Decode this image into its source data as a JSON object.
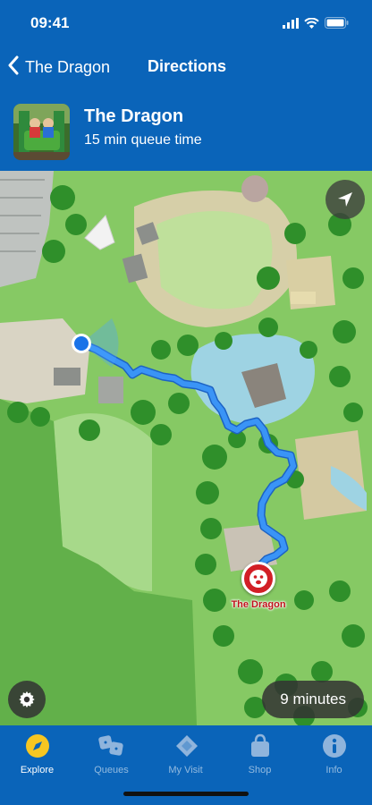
{
  "status_bar": {
    "time": "09:41"
  },
  "nav": {
    "back_label": "The Dragon",
    "title": "Directions"
  },
  "ride": {
    "name": "The Dragon",
    "queue_text": "15 min queue time"
  },
  "map": {
    "destination_label": "The Dragon",
    "eta_text": "9 minutes",
    "route_color": "#2a8bf2",
    "user_dot_color": "#1a73e8"
  },
  "tabs": [
    {
      "label": "Explore",
      "icon": "compass-icon",
      "active": true
    },
    {
      "label": "Queues",
      "icon": "dice-icon",
      "active": false
    },
    {
      "label": "My Visit",
      "icon": "ticket-icon",
      "active": false
    },
    {
      "label": "Shop",
      "icon": "shopping-bag-icon",
      "active": false
    },
    {
      "label": "Info",
      "icon": "info-icon",
      "active": false
    }
  ],
  "colors": {
    "brand_blue": "#0a64b9",
    "accent_yellow": "#f6c622",
    "pin_red": "#d21f26"
  }
}
